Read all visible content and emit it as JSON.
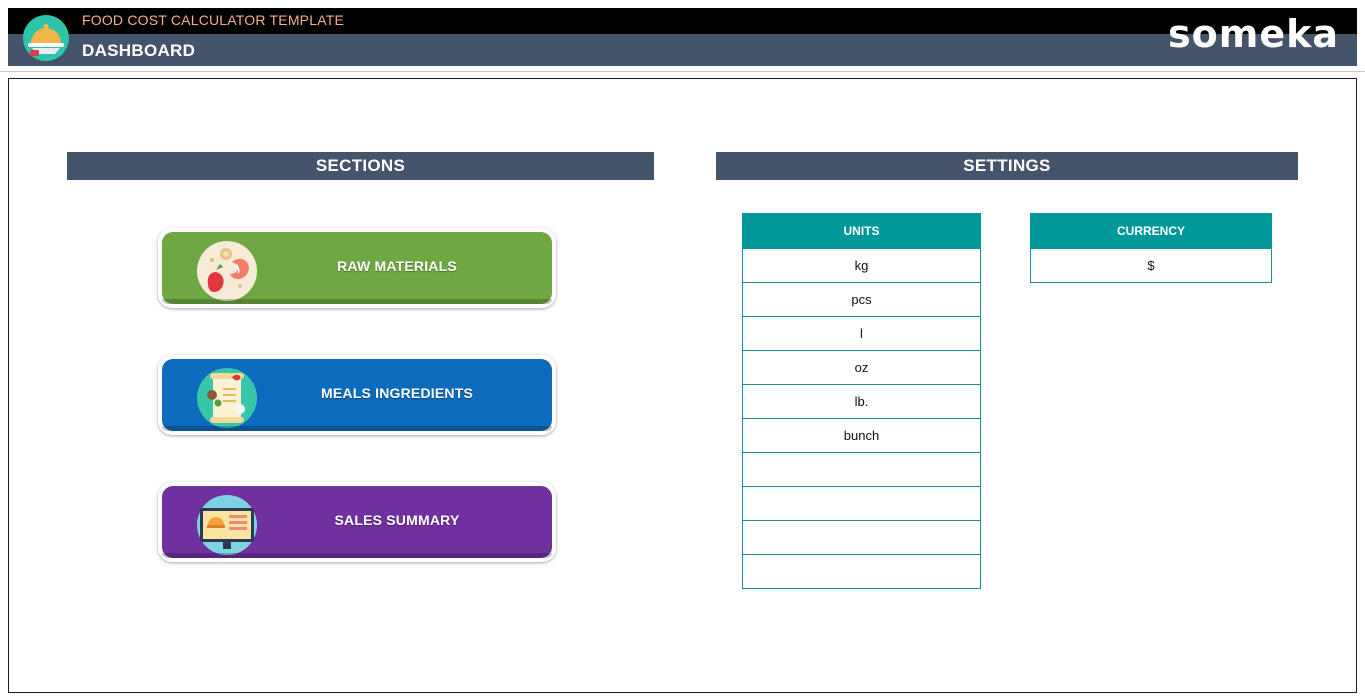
{
  "header": {
    "app_title": "FOOD COST CALCULATOR TEMPLATE",
    "page_title": "DASHBOARD",
    "brand": "someka"
  },
  "sections": {
    "title": "SECTIONS",
    "buttons": [
      {
        "label": "RAW MATERIALS",
        "color": "#6fa843",
        "icon": "vegetables-icon"
      },
      {
        "label": "MEALS INGREDIENTS",
        "color": "#0c6bbd",
        "icon": "recipe-scroll-icon"
      },
      {
        "label": "SALES SUMMARY",
        "color": "#7030a0",
        "icon": "sales-monitor-icon"
      }
    ]
  },
  "settings": {
    "title": "SETTINGS",
    "units": {
      "header": "UNITS",
      "values": [
        "kg",
        "pcs",
        "l",
        "oz",
        "lb.",
        "bunch",
        "",
        "",
        "",
        ""
      ]
    },
    "currency": {
      "header": "CURRENCY",
      "value": "$"
    }
  },
  "colors": {
    "header_dark": "#44546a",
    "table_teal": "#009999",
    "app_title": "#f4b183"
  }
}
